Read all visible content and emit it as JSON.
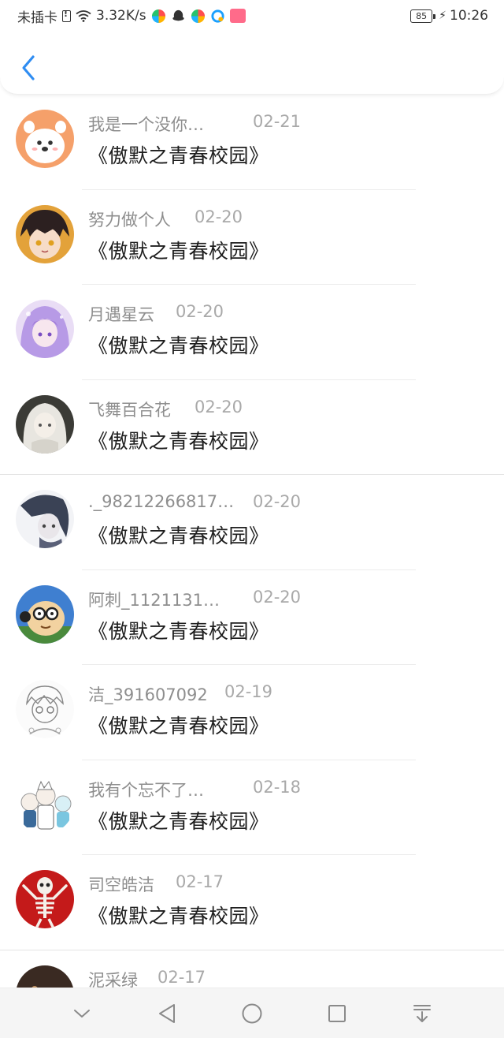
{
  "status_bar": {
    "carrier": "未插卡",
    "speed": "3.32K/s",
    "battery": "85",
    "time": "10:26"
  },
  "colors": {
    "accent": "#2f8df2",
    "name_text": "#8e8e8e",
    "date_text": "#a9a9a9",
    "title_text": "#1e1e1e"
  },
  "items": [
    {
      "name": "我是一个没你…",
      "date": "02-21",
      "title": "《傲默之青春校园》",
      "avatar_color": "#f5a06a"
    },
    {
      "name": "努力做个人",
      "date": "02-20",
      "title": "《傲默之青春校园》",
      "avatar_color": "#3b2a22"
    },
    {
      "name": "月遇星云",
      "date": "02-20",
      "title": "《傲默之青春校园》",
      "avatar_color": "#a58fd8"
    },
    {
      "name": "飞舞百合花",
      "date": "02-20",
      "title": "《傲默之青春校园》",
      "avatar_color": "#8a8a84"
    },
    {
      "name": "._98212266817…",
      "date": "02-20",
      "title": "《傲默之青春校园》",
      "avatar_color": "#50586e"
    },
    {
      "name": "阿刺_1121131…",
      "date": "02-20",
      "title": "《傲默之青春校园》",
      "avatar_color": "#3f7fd0"
    },
    {
      "name": "洁_391607092",
      "date": "02-19",
      "title": "《傲默之青春校园》",
      "avatar_color": "#eeeeee"
    },
    {
      "name": "我有个忘不了…",
      "date": "02-18",
      "title": "《傲默之青春校园》",
      "avatar_color": "#f2f2f2"
    },
    {
      "name": "司空皓洁",
      "date": "02-17",
      "title": "《傲默之青春校园》",
      "avatar_color": "#c41a1a"
    },
    {
      "name": "泥采绿",
      "date": "02-17",
      "title": "",
      "avatar_color": "#3a2a22"
    }
  ]
}
